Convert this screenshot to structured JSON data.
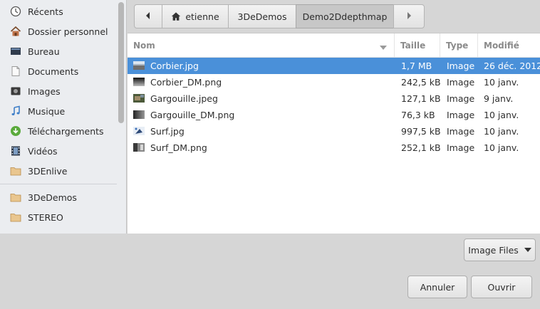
{
  "sidebar": {
    "items": [
      {
        "label": "Récents",
        "icon": "clock-icon"
      },
      {
        "label": "Dossier personnel",
        "icon": "home-icon"
      },
      {
        "label": "Bureau",
        "icon": "desktop-icon"
      },
      {
        "label": "Documents",
        "icon": "document-icon"
      },
      {
        "label": "Images",
        "icon": "camera-icon"
      },
      {
        "label": "Musique",
        "icon": "music-note-icon"
      },
      {
        "label": "Téléchargements",
        "icon": "download-icon"
      },
      {
        "label": "Vidéos",
        "icon": "film-icon"
      },
      {
        "label": "3DEnlive",
        "icon": "folder-icon"
      },
      {
        "label": "3DeDemos",
        "icon": "folder-icon"
      },
      {
        "label": "STEREO",
        "icon": "folder-icon"
      }
    ]
  },
  "pathbar": {
    "segments": [
      "etienne",
      "3DeDemos",
      "Demo2Ddepthmap"
    ]
  },
  "filelist": {
    "columns": [
      "Nom",
      "Taille",
      "Type",
      "Modifié"
    ],
    "rows": [
      {
        "name": "Corbier.jpg",
        "size": "1,7 MB",
        "type": "Image",
        "modified": "26 déc. 2012",
        "selected": true
      },
      {
        "name": "Corbier_DM.png",
        "size": "242,5 kB",
        "type": "Image",
        "modified": "10 janv."
      },
      {
        "name": "Gargouille.jpeg",
        "size": "127,1 kB",
        "type": "Image",
        "modified": "9 janv."
      },
      {
        "name": "Gargouille_DM.png",
        "size": "76,3 kB",
        "type": "Image",
        "modified": "10 janv."
      },
      {
        "name": "Surf.jpg",
        "size": "997,5 kB",
        "type": "Image",
        "modified": "10 janv."
      },
      {
        "name": "Surf_DM.png",
        "size": "252,1 kB",
        "type": "Image",
        "modified": "10 janv."
      }
    ]
  },
  "filter": {
    "label": "Image Files"
  },
  "actions": {
    "cancel": "Annuler",
    "open": "Ouvrir"
  },
  "colors": {
    "selection": "#4a90d9",
    "background": "#d6d6d6",
    "sidebar": "#ebedf0"
  }
}
